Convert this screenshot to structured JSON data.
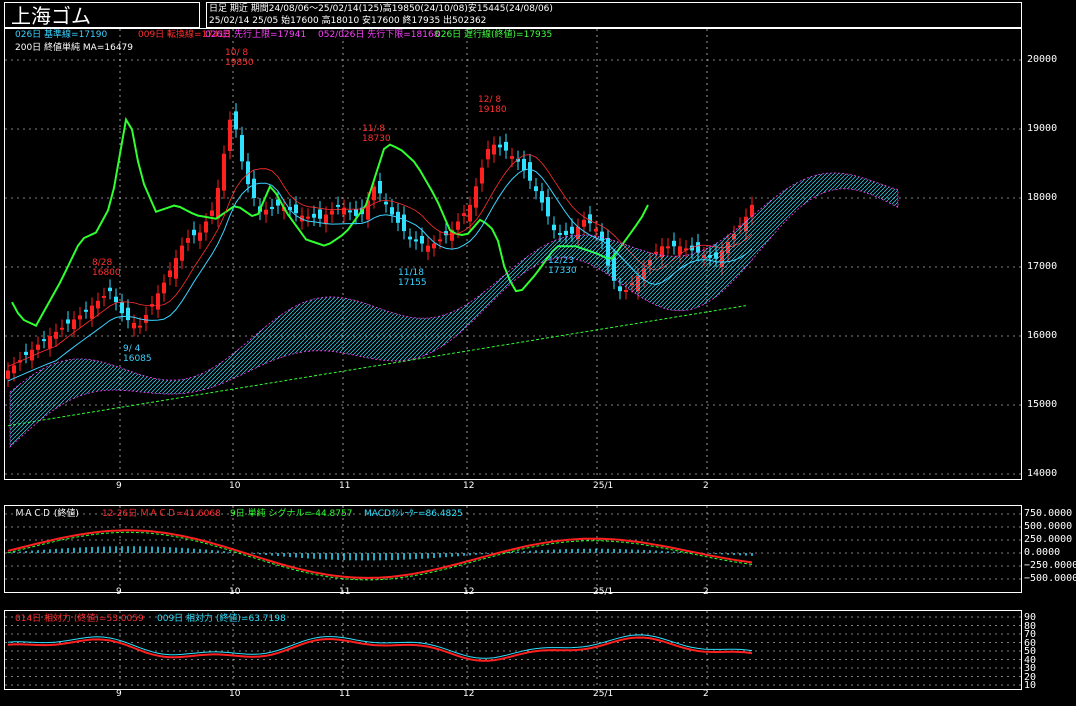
{
  "title": "上海ゴム",
  "header": {
    "line1": "日足  期近  期間24/08/06～25/02/14(125)高19850(24/10/08)安15445(24/08/06)",
    "line2": "25/02/14 25/05  始17600 高18010 安17600 終17935 出502362"
  },
  "indicators_main": [
    {
      "text": "026日 基準線=17190",
      "color": "#3cd2ff"
    },
    {
      "text": "009日 転換線=17418",
      "color": "#ff3030"
    },
    {
      "text": "026日 先行上限=17941",
      "color": "#ff40ff"
    },
    {
      "text": "052/026日 先行下限=18168",
      "color": "#ff40ff"
    },
    {
      "text": "026日 遅行線(終値)=17935",
      "color": "#40ff40"
    }
  ],
  "indicator_ma": {
    "text": "200日 終値単純 MA=16479",
    "color": "#40ff40"
  },
  "price_axis": [
    "20000",
    "19000",
    "18000",
    "17000",
    "16000",
    "15000",
    "14000"
  ],
  "date_axis": [
    "9",
    "10",
    "11",
    "12",
    "25/1",
    "2"
  ],
  "annotations": [
    {
      "text": "10/ 8",
      "sub": "19850",
      "color": "#ff3030"
    },
    {
      "text": "11/ 8",
      "sub": "18730",
      "color": "#ff3030"
    },
    {
      "text": "12/ 8",
      "sub": "19180",
      "color": "#ff3030"
    },
    {
      "text": "8/28",
      "sub": "16800",
      "color": "#ff3030"
    },
    {
      "text": "9/ 4",
      "sub": "16085",
      "color": "#3cd2ff"
    },
    {
      "text": "11/18",
      "sub": "17155",
      "color": "#3cd2ff"
    },
    {
      "text": "12/23",
      "sub": "17330",
      "color": "#3cd2ff"
    }
  ],
  "macd": {
    "label_name": "ＭＡＣＤ (終値)",
    "label_macd": "12-26日 ＭＡＣＤ=41.6068",
    "label_signal": "9日 単純 シグナル=-44.8757",
    "label_osc": "MACDｵｼﾚｰﾀｰ=86.4825",
    "axis": [
      "750.0000",
      "500.0000",
      "250.0000",
      "0.0000",
      "−250.0000",
      "−500.0000"
    ]
  },
  "rsi": {
    "label_a": "014日 相対力 (終値)=53.0059",
    "label_b": "009日 相対力 (終値)=63.7198",
    "axis": [
      "90",
      "80",
      "70",
      "60",
      "50",
      "40",
      "30",
      "20",
      "10"
    ]
  },
  "colors": {
    "up": "#ff2020",
    "down": "#30e0ff",
    "ma": "#30ff30",
    "cloud": "#ff40ff",
    "base": "#3cd2ff",
    "conv": "#ff3030"
  }
}
